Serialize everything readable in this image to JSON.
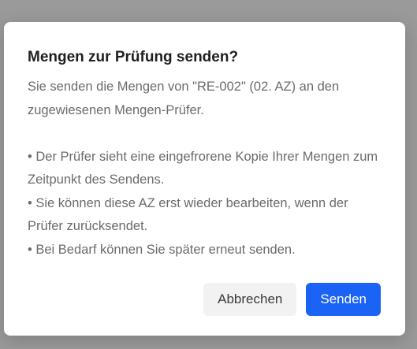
{
  "dialog": {
    "title": "Mengen zur Prüfung senden?",
    "intro": "Sie senden die Mengen von \"RE-002\" (02. AZ) an den zugewiesenen Mengen-Prüfer.",
    "bullets": [
      "• Der Prüfer sieht eine eingefrorene Kopie Ihrer Mengen zum Zeitpunkt des Sendens.",
      "• Sie können diese AZ erst wieder bearbeiten, wenn der Prüfer zurücksendet.",
      "• Bei Bedarf können Sie später erneut senden."
    ],
    "cancel_label": "Abbrechen",
    "confirm_label": "Senden"
  },
  "colors": {
    "primary": "#1a63f4",
    "overlay": "#9a9a9a"
  }
}
